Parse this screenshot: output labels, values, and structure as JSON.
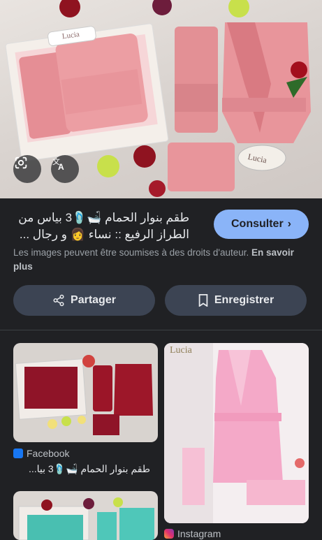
{
  "hero": {
    "box_label": "Lucia",
    "tag_label": "Lucia",
    "lens_icon": "google-lens-icon",
    "translate_icon": "translate-icon"
  },
  "result": {
    "title": "طقم بنوار الحمام 🛁🩴3 بياس من الطراز الرفيع :: نساء 👩 و رجال ...",
    "visit_button": "Consulter",
    "rights_text": "Les images peuvent être soumises à des droits d'auteur.",
    "learn_more": "En savoir plus",
    "share_label": "Partager",
    "save_label": "Enregistrer"
  },
  "related": [
    {
      "source": "Facebook",
      "caption": "طقم بنوار الحمام 🛁🩴3 بيا..."
    },
    {
      "source": "Instagram",
      "overlay_text": "Lucia"
    },
    {
      "source": ""
    }
  ],
  "colors": {
    "accent": "#8ab4f8",
    "background": "#202124",
    "pill": "#3c4453"
  }
}
